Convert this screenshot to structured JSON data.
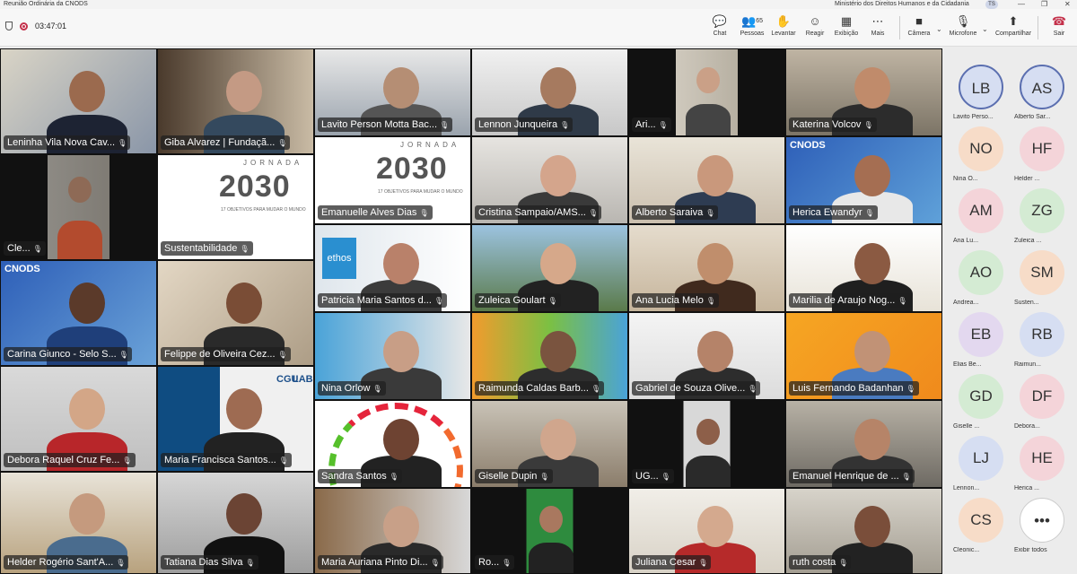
{
  "window": {
    "title": "Reunião Ordinária da CNODS",
    "org": "Ministério dos Direitos Humanos e da Cidadania",
    "user_initials": "TS",
    "controls": [
      "—",
      "❐",
      "✕"
    ]
  },
  "toolbar": {
    "timer": "03:47:01",
    "buttons": [
      {
        "label": "Chat",
        "icon": "chat-icon",
        "glyph": "💬"
      },
      {
        "label": "Pessoas",
        "icon": "people-icon",
        "glyph": "👥",
        "count": "65"
      },
      {
        "label": "Levantar",
        "icon": "raise-hand-icon",
        "glyph": "✋"
      },
      {
        "label": "Reagir",
        "icon": "react-icon",
        "glyph": "☺"
      },
      {
        "label": "Exibição",
        "icon": "view-icon",
        "glyph": "▦"
      },
      {
        "label": "Mais",
        "icon": "more-icon",
        "glyph": "⋯"
      },
      {
        "label": "Câmera",
        "icon": "camera-icon",
        "glyph": "■"
      },
      {
        "label": "Microfone",
        "icon": "microphone-icon",
        "glyph": "🎙"
      },
      {
        "label": "Compartilhar",
        "icon": "share-icon",
        "glyph": "⬆"
      },
      {
        "label": "Sair",
        "icon": "leave-icon",
        "glyph": "☎"
      }
    ]
  },
  "tiles": [
    {
      "name": "Leninha Vila Nova Cav..."
    },
    {
      "name": "Giba Alvarez | Fundaçã..."
    },
    {
      "name": "Lavito Person Motta Bac..."
    },
    {
      "name": "Lennon Junqueira"
    },
    {
      "name": "Ari..."
    },
    {
      "name": "Katerina Volcov"
    },
    {
      "name": "Cle..."
    },
    {
      "name": "Sustentabilidade"
    },
    {
      "name": "Emanuelle Alves Dias"
    },
    {
      "name": "Cristina Sampaio/AMS..."
    },
    {
      "name": "Alberto Saraiva"
    },
    {
      "name": "Herica Ewandyr"
    },
    {
      "name": "Patricia Maria Santos d..."
    },
    {
      "name": "Zuleica Goulart"
    },
    {
      "name": "Ana Lucia Melo"
    },
    {
      "name": "Marilia de Araujo Nog..."
    },
    {
      "name": "Carina Giunco - Selo S..."
    },
    {
      "name": "Felippe de Oliveira Cez..."
    },
    {
      "name": "Nina Orlow"
    },
    {
      "name": "Raimunda Caldas Barb..."
    },
    {
      "name": "Gabriel de Souza Olive..."
    },
    {
      "name": "Luis Fernando Badanhan"
    },
    {
      "name": "Debora Raquel Cruz Fe..."
    },
    {
      "name": "Maria Francisca Santos..."
    },
    {
      "name": "Sandra Santos"
    },
    {
      "name": "Giselle Dupin"
    },
    {
      "name": "UG..."
    },
    {
      "name": "Emanuel Henrique de ..."
    },
    {
      "name": "Helder Rogério Sant'A..."
    },
    {
      "name": "Tatiana Dias Silva"
    },
    {
      "name": "Maria Auriana Pinto Di..."
    },
    {
      "name": "Ro..."
    },
    {
      "name": "Juliana Cesar"
    },
    {
      "name": "ruth costa"
    }
  ],
  "tile_texts": {
    "jornada": "JORNADA",
    "logo_2030": "2030",
    "logo_sub": "17 OBJETIVOS PARA MUDAR O MUNDO",
    "cnods": "CNODS",
    "ethos": "ethos",
    "cgu": "CGU",
    "lab": "LAB"
  },
  "participants": [
    {
      "initials": "LB",
      "name": "Lavito Perso..."
    },
    {
      "initials": "AS",
      "name": "Alberto Sar..."
    },
    {
      "initials": "NO",
      "name": "Nina O..."
    },
    {
      "initials": "HF",
      "name": "Helder ..."
    },
    {
      "initials": "AM",
      "name": "Ana Lu..."
    },
    {
      "initials": "ZG",
      "name": "Zuleica ..."
    },
    {
      "initials": "AO",
      "name": "Andrea..."
    },
    {
      "initials": "SM",
      "name": "Susten..."
    },
    {
      "initials": "EB",
      "name": "Elias Be..."
    },
    {
      "initials": "RB",
      "name": "Raimun..."
    },
    {
      "initials": "GD",
      "name": "Giselle ..."
    },
    {
      "initials": "DF",
      "name": "Debora..."
    },
    {
      "initials": "LJ",
      "name": "Lennon..."
    },
    {
      "initials": "HE",
      "name": "Herica ..."
    },
    {
      "initials": "CS",
      "name": "Cleonic..."
    },
    {
      "initials": "•••",
      "name": "Exibir todos"
    }
  ],
  "colors": {
    "avatar_blue": "#d6def2",
    "avatar_peach": "#f7dcc8",
    "avatar_green": "#d4ebd3",
    "avatar_pink": "#f4d4d9",
    "avatar_lilac": "#e3d8ef",
    "leave_red": "#c4314b"
  }
}
